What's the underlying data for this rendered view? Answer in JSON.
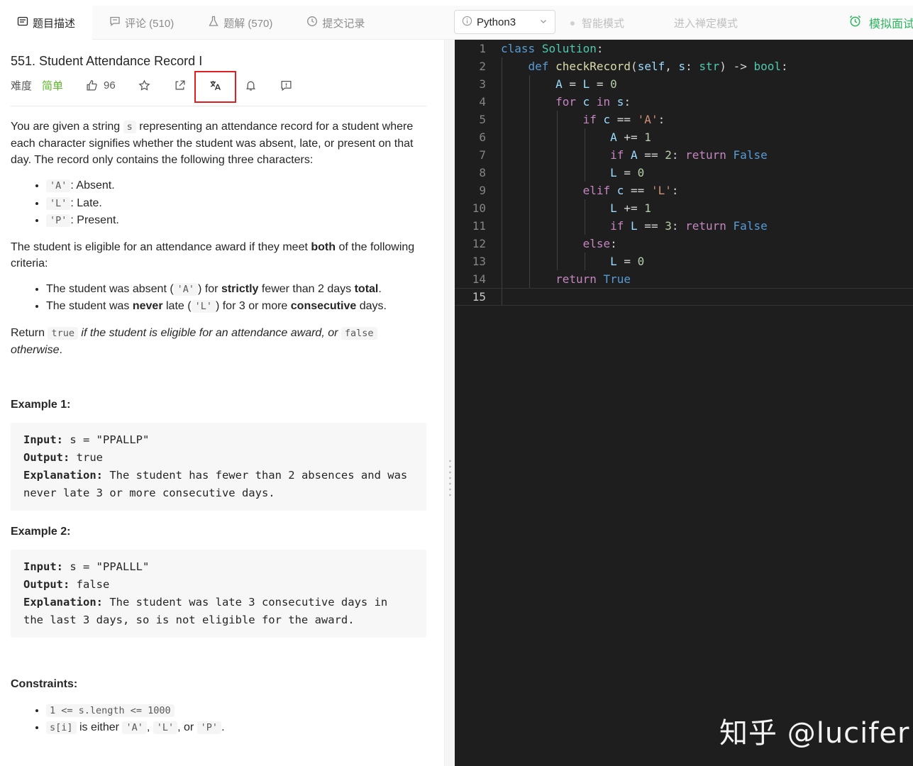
{
  "tabs": [
    {
      "label": "题目描述",
      "icon": "description-icon"
    },
    {
      "label": "评论 (510)",
      "icon": "comment-icon"
    },
    {
      "label": "题解 (570)",
      "icon": "flask-icon"
    },
    {
      "label": "提交记录",
      "icon": "clock-icon"
    }
  ],
  "problem": {
    "title": "551. Student Attendance Record I",
    "difficulty_label": "难度",
    "difficulty": "简单",
    "likes": "96",
    "para1_a": "You are given a string ",
    "para1_code": "s",
    "para1_b": " representing an attendance record for a student where each character signifies whether the student was absent, late, or present on that day. The record only contains the following three characters:",
    "chars": [
      {
        "code": "'A'",
        "text": ": Absent."
      },
      {
        "code": "'L'",
        "text": ": Late."
      },
      {
        "code": "'P'",
        "text": ": Present."
      }
    ],
    "para2_a": "The student is eligible for an attendance award if they meet ",
    "para2_bold": "both",
    "para2_b": " of the following criteria:",
    "crit1_a": "The student was absent (",
    "crit1_code": "'A'",
    "crit1_b": ") for ",
    "crit1_bold1": "strictly",
    "crit1_c": " fewer than 2 days ",
    "crit1_bold2": "total",
    "crit1_d": ".",
    "crit2_a": "The student was ",
    "crit2_bold1": "never",
    "crit2_b": " late (",
    "crit2_code": "'L'",
    "crit2_c": ") for 3 or more ",
    "crit2_bold2": "consecutive",
    "crit2_d": " days.",
    "ret_a": "Return ",
    "ret_code1": "true",
    "ret_b": " if the student is eligible for an attendance award, or ",
    "ret_code2": "false",
    "ret_c": "otherwise",
    "ret_d": ".",
    "ex1_title": "Example 1:",
    "ex1": {
      "in_label": "Input:",
      "in": " s = \"PPALLP\"",
      "out_label": "Output:",
      "out": " true",
      "exp_label": "Explanation:",
      "exp": " The student has fewer than 2 absences and was never late 3 or more consecutive days."
    },
    "ex2_title": "Example 2:",
    "ex2": {
      "in_label": "Input:",
      "in": " s = \"PPALLL\"",
      "out_label": "Output:",
      "out": " false",
      "exp_label": "Explanation:",
      "exp": " The student was late 3 consecutive days in the last 3 days, so is not eligible for the award."
    },
    "constraints_title": "Constraints:",
    "c1": "1 <= s.length <= 1000",
    "c2_code": "s[i]",
    "c2_a": " is either ",
    "c2_A": "'A'",
    "c2_comma": ", ",
    "c2_L": "'L'",
    "c2_or": ", or ",
    "c2_P": "'P'",
    "c2_end": "."
  },
  "editor": {
    "language": "Python3",
    "smart_mode": "智能模式",
    "zen_mode": "进入禅定模式",
    "mock_interview": "模拟面试",
    "current_line": 15
  },
  "watermark": "知乎 @lucifer",
  "colors": {
    "accent_green": "#2db55d",
    "easy_green": "#5ab726",
    "highlight_red": "#e02020",
    "editor_bg": "#1e1e1e"
  }
}
